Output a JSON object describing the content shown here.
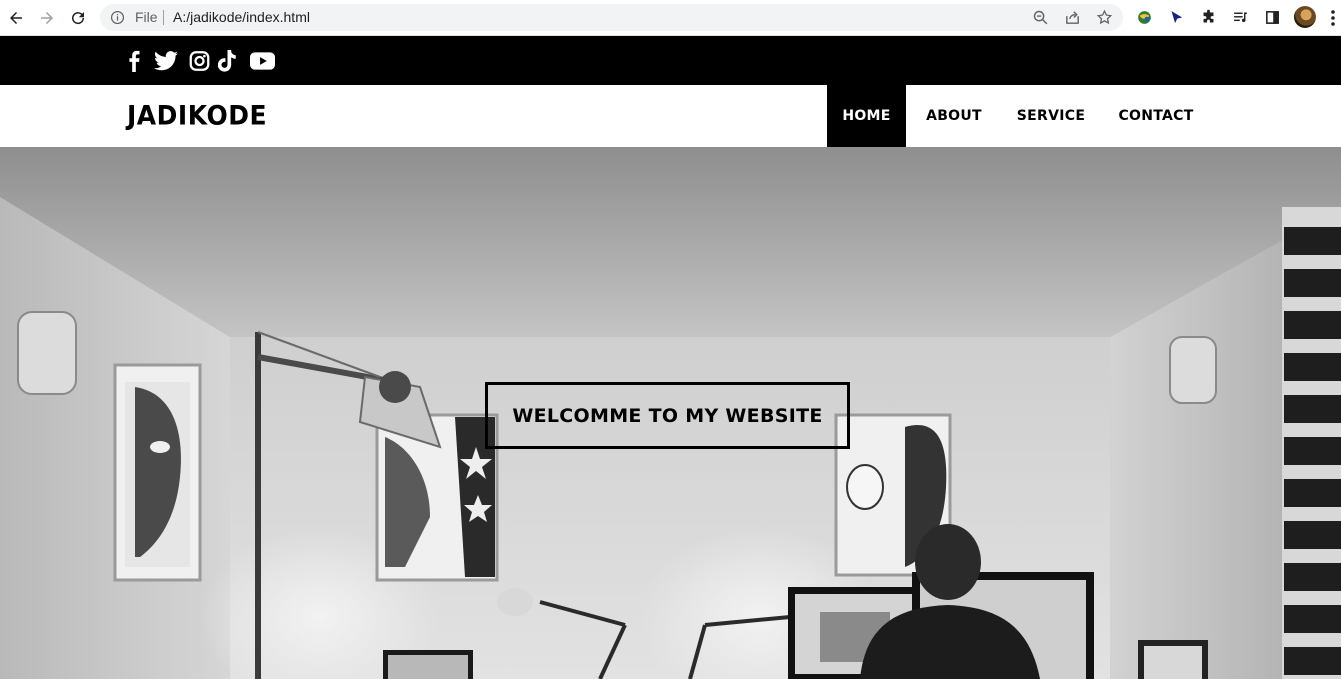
{
  "browser": {
    "scheme_label": "File",
    "url": "A:/jadikode/index.html",
    "toolbar_icons": [
      "back-icon",
      "forward-icon",
      "reload-icon",
      "info-icon",
      "zoom-icon",
      "share-icon",
      "star-icon",
      "extension-globe-icon",
      "extension-arrow-icon",
      "puzzle-icon",
      "media-queue-icon",
      "side-panel-icon",
      "profile-avatar",
      "menu-dots-icon"
    ]
  },
  "social": {
    "icons": [
      "facebook-icon",
      "twitter-icon",
      "instagram-icon",
      "tiktok-icon",
      "youtube-icon"
    ],
    "bar_color": "#000000"
  },
  "header": {
    "logo": "JADIKODE",
    "nav": [
      {
        "label": "HOME",
        "active": true
      },
      {
        "label": "ABOUT",
        "active": false
      },
      {
        "label": "SERVICE",
        "active": false
      },
      {
        "label": "CONTACT",
        "active": false
      }
    ]
  },
  "hero": {
    "title": "WELCOMME TO MY WEBSITE",
    "background": "grayscale office photo"
  }
}
